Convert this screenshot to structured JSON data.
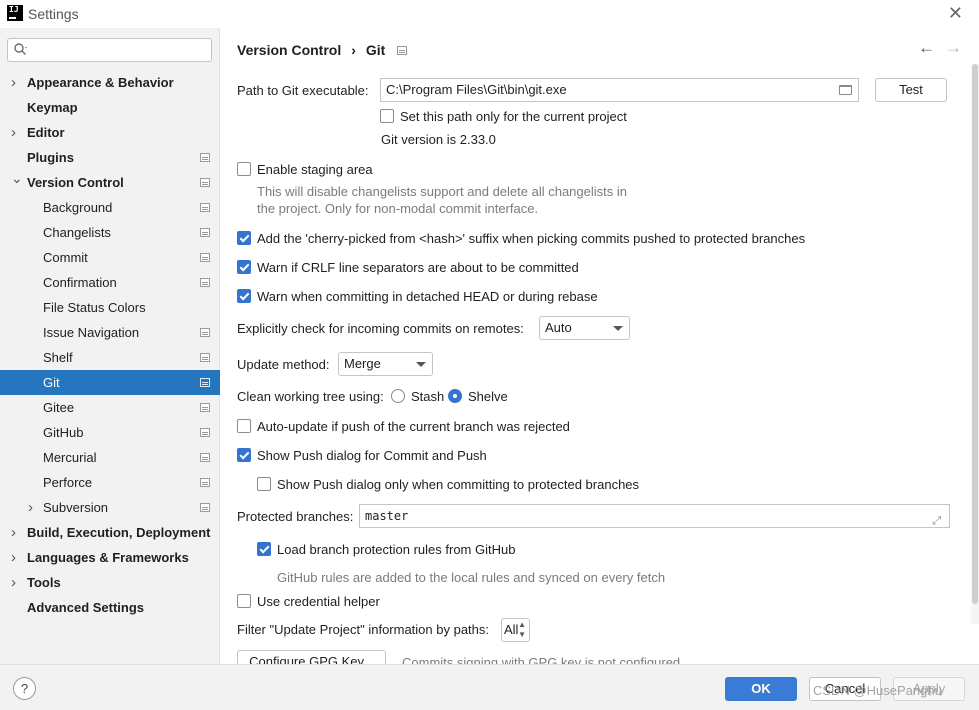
{
  "window": {
    "title": "Settings",
    "logo_text": "IJ"
  },
  "search": {
    "placeholder": "",
    "value": ""
  },
  "sidebar": {
    "items": [
      {
        "label": "Appearance & Behavior",
        "level": 0,
        "chevron": "right",
        "proj": false
      },
      {
        "label": "Keymap",
        "level": 0,
        "chevron": "",
        "proj": false
      },
      {
        "label": "Editor",
        "level": 0,
        "chevron": "right",
        "proj": false
      },
      {
        "label": "Plugins",
        "level": 0,
        "chevron": "",
        "proj": true
      },
      {
        "label": "Version Control",
        "level": 0,
        "chevron": "down",
        "proj": true
      },
      {
        "label": "Background",
        "level": 1,
        "chevron": "",
        "proj": true
      },
      {
        "label": "Changelists",
        "level": 1,
        "chevron": "",
        "proj": true
      },
      {
        "label": "Commit",
        "level": 1,
        "chevron": "",
        "proj": true
      },
      {
        "label": "Confirmation",
        "level": 1,
        "chevron": "",
        "proj": true
      },
      {
        "label": "File Status Colors",
        "level": 1,
        "chevron": "",
        "proj": false
      },
      {
        "label": "Issue Navigation",
        "level": 1,
        "chevron": "",
        "proj": true
      },
      {
        "label": "Shelf",
        "level": 1,
        "chevron": "",
        "proj": true
      },
      {
        "label": "Git",
        "level": 1,
        "chevron": "",
        "proj": true,
        "selected": true
      },
      {
        "label": "Gitee",
        "level": 1,
        "chevron": "",
        "proj": true
      },
      {
        "label": "GitHub",
        "level": 1,
        "chevron": "",
        "proj": true
      },
      {
        "label": "Mercurial",
        "level": 1,
        "chevron": "",
        "proj": true
      },
      {
        "label": "Perforce",
        "level": 1,
        "chevron": "",
        "proj": true
      },
      {
        "label": "Subversion",
        "level": 1,
        "chevron": "right",
        "proj": true
      },
      {
        "label": "Build, Execution, Deployment",
        "level": 0,
        "chevron": "right",
        "proj": false
      },
      {
        "label": "Languages & Frameworks",
        "level": 0,
        "chevron": "right",
        "proj": false
      },
      {
        "label": "Tools",
        "level": 0,
        "chevron": "right",
        "proj": false
      },
      {
        "label": "Advanced Settings",
        "level": 0,
        "chevron": "",
        "proj": false
      }
    ]
  },
  "breadcrumb": {
    "parent": "Version Control",
    "separator": "›",
    "current": "Git"
  },
  "git": {
    "path_label": "Path to Git executable:",
    "path_value": "C:\\Program Files\\Git\\bin\\git.exe",
    "test_button": "Test",
    "path_only_current_label": "Set this path only for the current project",
    "version_text": "Git version is 2.33.0",
    "staging_label": "Enable staging area",
    "staging_desc_1": "This will disable changelists support and delete all changelists in",
    "staging_desc_2": "the project. Only for non-modal commit interface.",
    "cherry_pick_label": "Add the 'cherry-picked from <hash>' suffix when picking commits pushed to protected branches",
    "crlf_label": "Warn if CRLF line separators are about to be committed",
    "detached_label": "Warn when committing in detached HEAD or during rebase",
    "incoming_label": "Explicitly check for incoming commits on remotes:",
    "incoming_value": "Auto",
    "update_method_label": "Update method:",
    "update_method_value": "Merge",
    "clean_tree_label": "Clean working tree using:",
    "stash_label": "Stash",
    "shelve_label": "Shelve",
    "auto_update_label": "Auto-update if push of the current branch was rejected",
    "show_push_label": "Show Push dialog for Commit and Push",
    "show_push_protected_label": "Show Push dialog only when committing to protected branches",
    "protected_label": "Protected branches:",
    "protected_value": "master",
    "load_rules_label": "Load branch protection rules from GitHub",
    "rules_desc": "GitHub rules are added to the local rules and synced on every fetch",
    "credential_label": "Use credential helper",
    "filter_label": "Filter \"Update Project\" information by paths:",
    "filter_value": "All",
    "gpg_button": "Configure GPG Key...",
    "gpg_status": "Commits signing with GPG key is not configured"
  },
  "states": {
    "path_only_current": false,
    "staging": false,
    "cherry_pick": true,
    "crlf": true,
    "detached": true,
    "clean_tree": "Shelve",
    "auto_update": false,
    "show_push": true,
    "show_push_protected": false,
    "load_rules": true,
    "credential": false
  },
  "footer": {
    "help": "?",
    "ok": "OK",
    "cancel": "Cancel",
    "apply": "Apply",
    "watermark": "CSDN @HusePanghu"
  },
  "colors": {
    "selection": "#2675bf",
    "accent": "#3474d0",
    "ok_button": "#3a7bd5",
    "sidebar_bg": "#f2f2f2"
  }
}
